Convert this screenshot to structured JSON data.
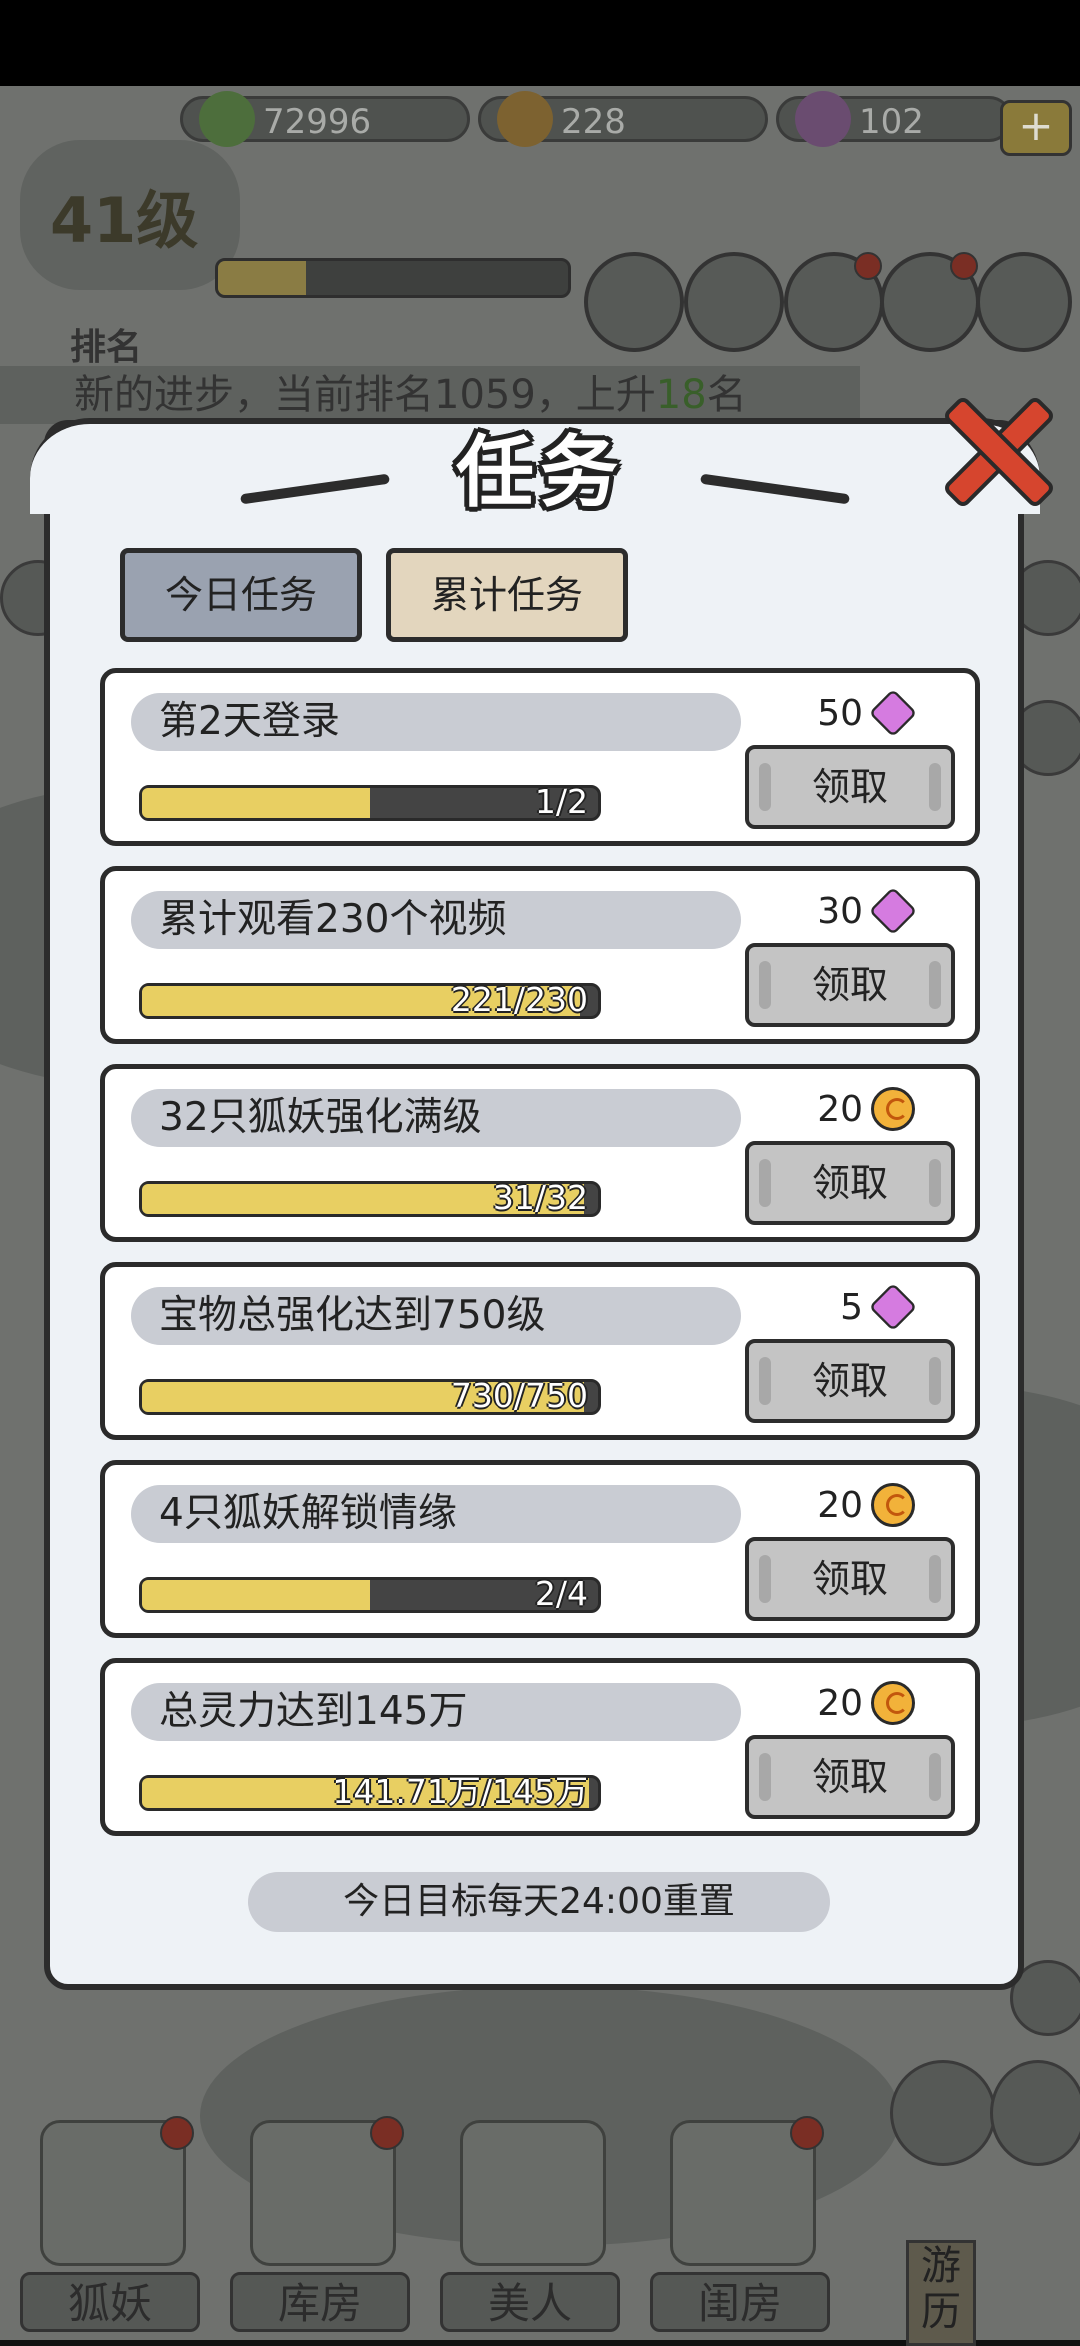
{
  "hud": {
    "resources": [
      {
        "icon": "green-flame-icon",
        "value": "72996"
      },
      {
        "icon": "orange-coin-icon",
        "value": "228"
      },
      {
        "icon": "purple-gem-icon",
        "value": "102"
      }
    ],
    "plus_label": "+",
    "level_text": "41级",
    "level_progress": 0.25,
    "rank_title": "排名",
    "ticker": {
      "prefix": "新的进步，当前排名1059，上升",
      "highlight": "18",
      "suffix": "名"
    }
  },
  "dialog": {
    "title": "任务",
    "tabs": [
      {
        "label": "今日任务",
        "selected": false
      },
      {
        "label": "累计任务",
        "selected": true
      }
    ],
    "tasks": [
      {
        "name": "第2天登录",
        "progress_text": "1/2",
        "progress": 0.5,
        "reward_amount": "50",
        "reward_icon": "purple-gem-icon",
        "claim_label": "领取"
      },
      {
        "name": "累计观看230个视频",
        "progress_text": "221/230",
        "progress": 0.96,
        "reward_amount": "30",
        "reward_icon": "purple-gem-icon",
        "claim_label": "领取"
      },
      {
        "name": "32只狐妖强化满级",
        "progress_text": "31/32",
        "progress": 0.97,
        "reward_amount": "20",
        "reward_icon": "orange-coin-icon",
        "claim_label": "领取"
      },
      {
        "name": "宝物总强化达到750级",
        "progress_text": "730/750",
        "progress": 0.97,
        "reward_amount": "5",
        "reward_icon": "purple-gem-icon",
        "claim_label": "领取"
      },
      {
        "name": "4只狐妖解锁情缘",
        "progress_text": "2/4",
        "progress": 0.5,
        "reward_amount": "20",
        "reward_icon": "orange-coin-icon",
        "claim_label": "领取"
      },
      {
        "name": "总灵力达到145万",
        "progress_text": "141.71万/145万",
        "progress": 0.98,
        "reward_amount": "20",
        "reward_icon": "orange-coin-icon",
        "claim_label": "领取"
      }
    ],
    "footer": "今日目标每天24:00重置"
  },
  "nav": {
    "items": [
      {
        "label": "狐妖"
      },
      {
        "label": "库房"
      },
      {
        "label": "美人"
      },
      {
        "label": "闺房"
      }
    ],
    "side_label": "游历"
  },
  "colors": {
    "progress_fill": "#e8cf62",
    "tab_selected": "#e3d6be",
    "tab_unselected": "#9aa2b0",
    "close_red": "#d6452e"
  }
}
